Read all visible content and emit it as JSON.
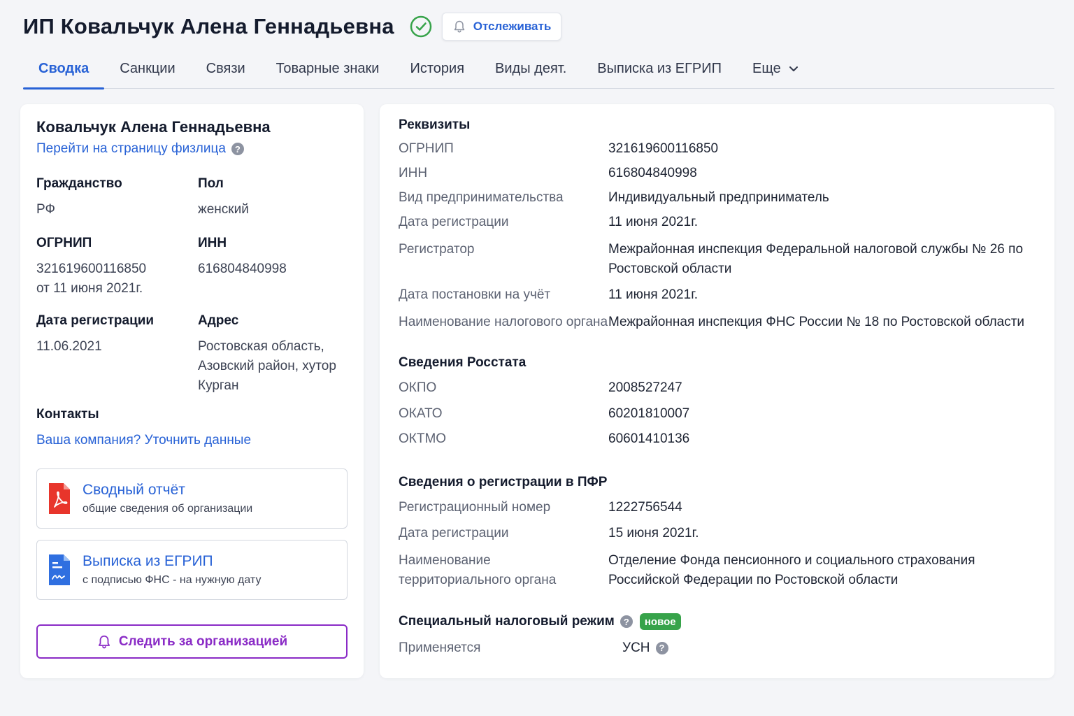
{
  "header": {
    "title": "ИП Ковальчук Алена Геннадьевна",
    "track_label": "Отслеживать"
  },
  "tabs": [
    {
      "label": "Сводка",
      "active": true
    },
    {
      "label": "Санкции"
    },
    {
      "label": "Связи"
    },
    {
      "label": "Товарные знаки"
    },
    {
      "label": "История"
    },
    {
      "label": "Виды деят."
    },
    {
      "label": "Выписка из ЕГРИП"
    },
    {
      "label": "Еще"
    }
  ],
  "left": {
    "name": "Ковальчук Алена Геннадьевна",
    "person_link": "Перейти на страницу физлица",
    "citizenship_label": "Гражданство",
    "citizenship_value": "РФ",
    "gender_label": "Пол",
    "gender_value": "женский",
    "ogrnip_label": "ОГРНИП",
    "ogrnip_value": "321619600116850",
    "ogrnip_date": "от 11 июня 2021г.",
    "inn_label": "ИНН",
    "inn_value": "616804840998",
    "regdate_label": "Дата регистрации",
    "regdate_value": "11.06.2021",
    "address_label": "Адрес",
    "address_value": "Ростовская область, Азовский район, хутор Курган",
    "contacts_label": "Контакты",
    "contacts_link": "Ваша компания? Уточнить данные",
    "report_title": "Сводный отчёт",
    "report_sub": "общие сведения об организации",
    "extract_title": "Выписка из ЕГРИП",
    "extract_sub": "с подписью ФНС - на нужную дату",
    "follow_label": "Следить за организацией"
  },
  "right": {
    "requisites_title": "Реквизиты",
    "requisites": [
      {
        "k": "ОГРНИП",
        "v": "321619600116850"
      },
      {
        "k": "ИНН",
        "v": "616804840998"
      },
      {
        "k": "Вид предпринимательства",
        "v": "Индивидуальный предприниматель"
      },
      {
        "k": "Дата регистрации",
        "v": "11 июня 2021г."
      },
      {
        "k": "Регистратор",
        "v": "Межрайонная инспекция Федеральной налоговой службы № 26 по Ростовской области"
      },
      {
        "k": "Дата постановки на учёт",
        "v": "11 июня 2021г."
      },
      {
        "k": "Наименование налогового органа",
        "v": "Межрайонная инспекция ФНС России № 18 по Ростовской области"
      }
    ],
    "rosstat_title": "Сведения Росстата",
    "rosstat": [
      {
        "k": "ОКПО",
        "v": "2008527247"
      },
      {
        "k": "ОКАТО",
        "v": "60201810007"
      },
      {
        "k": "ОКТМО",
        "v": "60601410136"
      }
    ],
    "pfr_title": "Сведения о регистрации в ПФР",
    "pfr": [
      {
        "k": "Регистрационный номер",
        "v": "1222756544"
      },
      {
        "k": "Дата регистрации",
        "v": "15 июня 2021г."
      },
      {
        "k": "Наименование территориального органа",
        "v": "Отделение Фонда пенсионного и социального страхования Российской Федерации по Ростовской области"
      }
    ],
    "tax_title": "Специальный налоговый режим",
    "tax_badge": "новое",
    "tax_applied_label": "Применяется",
    "tax_applied_value": "УСН"
  },
  "colors": {
    "accent": "#2862d6",
    "purple": "#8a2bc6",
    "success": "#37a34a",
    "pdf_red": "#e8352b"
  },
  "icons": [
    "check-circle-icon",
    "bell-icon",
    "chevron-down-icon",
    "help-icon",
    "pdf-icon",
    "document-icon"
  ]
}
